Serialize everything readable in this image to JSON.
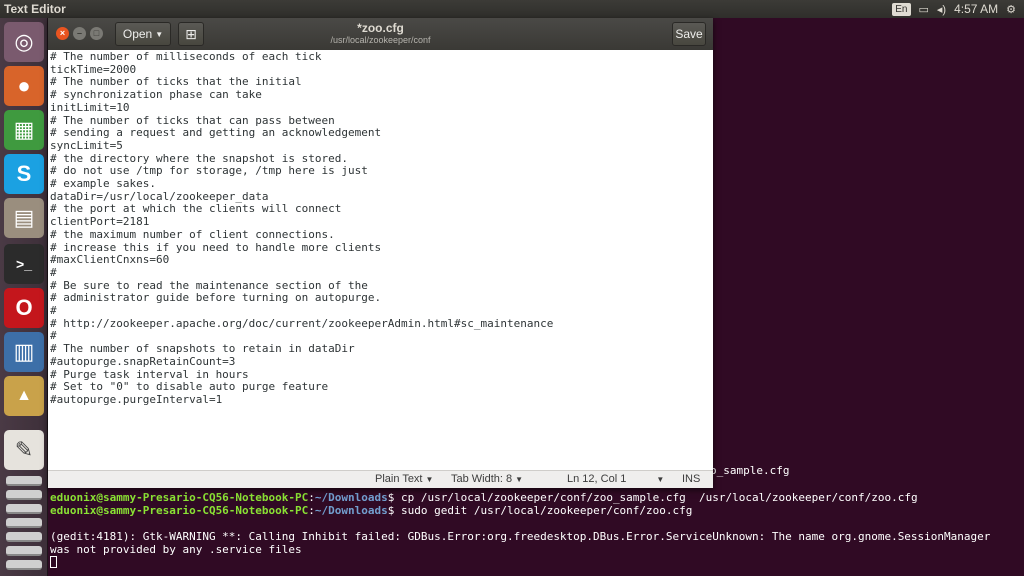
{
  "top_panel": {
    "title": "Text Editor",
    "lang": "En",
    "clock": "4:57 AM"
  },
  "gedit": {
    "open_label": "Open",
    "title": "*zoo.cfg",
    "subtitle": "/usr/local/zookeeper/conf",
    "save_label": "Save",
    "lines": [
      "# The number of milliseconds of each tick",
      "tickTime=2000",
      "# The number of ticks that the initial",
      "# synchronization phase can take",
      "initLimit=10",
      "# The number of ticks that can pass between",
      "# sending a request and getting an acknowledgement",
      "syncLimit=5",
      "# the directory where the snapshot is stored.",
      "# do not use /tmp for storage, /tmp here is just",
      "# example sakes.",
      "dataDir=/usr/local/zookeeper_data",
      "# the port at which the clients will connect",
      "clientPort=2181",
      "# the maximum number of client connections.",
      "# increase this if you need to handle more clients",
      "#maxClientCnxns=60",
      "#",
      "# Be sure to read the maintenance section of the",
      "# administrator guide before turning on autopurge.",
      "#",
      "# http://zookeeper.apache.org/doc/current/zookeeperAdmin.html#sc_maintenance",
      "#",
      "# The number of snapshots to retain in dataDir",
      "#autopurge.snapRetainCount=3",
      "# Purge task interval in hours",
      "# Set to \"0\" to disable auto purge feature",
      "#autopurge.purgeInterval=1"
    ],
    "status": {
      "language": "Plain Text",
      "tab_width": "Tab Width: 8",
      "position": "Ln 12, Col 1",
      "mode": "INS"
    }
  },
  "terminal": {
    "partial_line": "o_sample.cfg",
    "prompt_user": "eduonix@sammy-Presario-CQ56-Notebook-PC",
    "prompt_sep": ":",
    "prompt_path": "~/Downloads",
    "prompt_end": "$ ",
    "cmd1": "cp /usr/local/zookeeper/conf/zoo_sample.cfg  /usr/local/zookeeper/conf/zoo.cfg",
    "cmd2": "sudo gedit /usr/local/zookeeper/conf/zoo.cfg",
    "warning1": "(gedit:4181): Gtk-WARNING **: Calling Inhibit failed: GDBus.Error:org.freedesktop.DBus.Error.ServiceUnknown: The name org.gnome.SessionManager",
    "warning2": "was not provided by any .service files"
  }
}
